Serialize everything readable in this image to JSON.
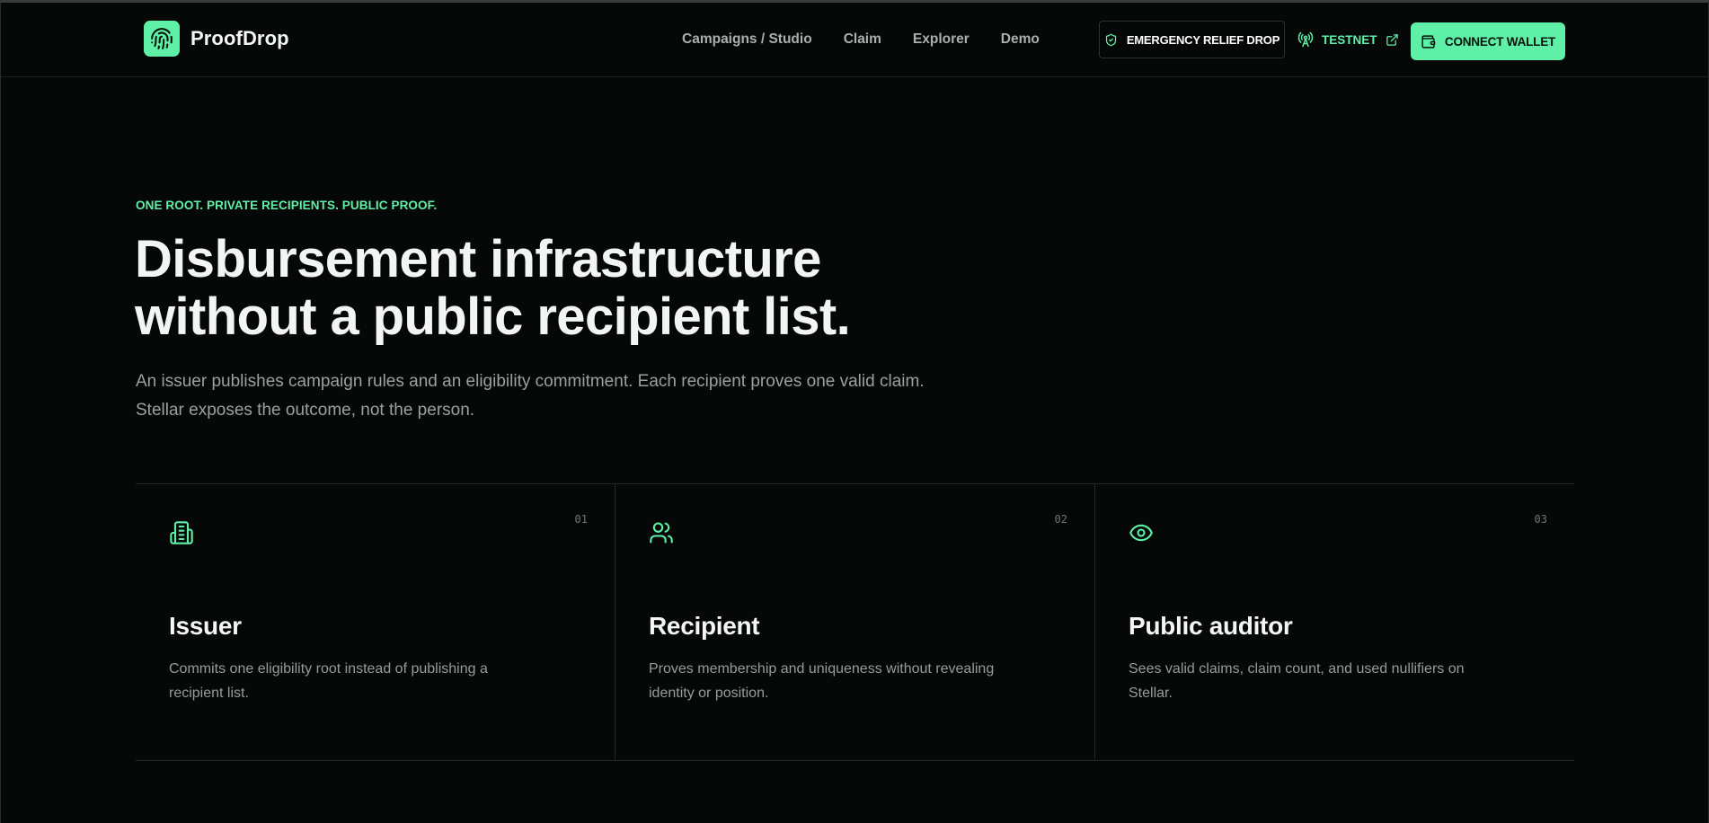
{
  "header": {
    "brand": "ProofDrop",
    "nav": [
      "Campaigns / Studio",
      "Claim",
      "Explorer",
      "Demo"
    ],
    "campaign_badge": "EMERGENCY RELIEF DROP",
    "network": "TESTNET",
    "connect_label": "CONNECT WALLET"
  },
  "hero": {
    "eyebrow": "ONE ROOT. PRIVATE RECIPIENTS. PUBLIC PROOF.",
    "headline_line1": "Disbursement infrastructure",
    "headline_line2": "without a public recipient list.",
    "subtext": "An issuer publishes campaign rules and an eligibility commitment. Each recipient proves one valid claim. Stellar exposes the outcome, not the person."
  },
  "roles": [
    {
      "num": "01",
      "icon": "building-icon",
      "title": "Issuer",
      "desc": "Commits one eligibility root instead of publishing a recipient list."
    },
    {
      "num": "02",
      "icon": "users-icon",
      "title": "Recipient",
      "desc": "Proves membership and uniqueness without revealing identity or position."
    },
    {
      "num": "03",
      "icon": "eye-icon",
      "title": "Public auditor",
      "desc": "Sees valid claims, claim count, and used nullifiers on Stellar."
    }
  ],
  "colors": {
    "accent": "#5ef0a7",
    "background": "#060807",
    "text": "#f3f5f4",
    "muted": "#9aa19e"
  }
}
